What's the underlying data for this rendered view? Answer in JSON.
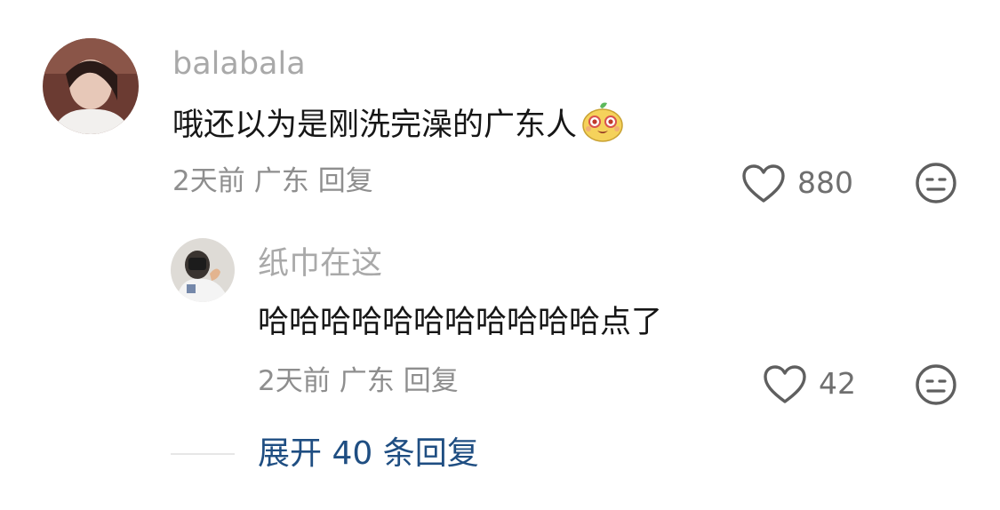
{
  "comments": [
    {
      "username": "balabala",
      "text": "哦还以为是刚洗完澡的广东人",
      "emoji": "melon-face-emoji",
      "meta": {
        "time": "2天前",
        "location": "广东",
        "reply": "回复"
      },
      "likes": "880"
    }
  ],
  "replies": [
    {
      "username": "纸巾在这",
      "text": "哈哈哈哈哈哈哈哈哈哈哈点了",
      "meta": {
        "time": "2天前",
        "location": "广东",
        "reply": "回复"
      },
      "likes": "42"
    }
  ],
  "expand": {
    "label": "展开 40 条回复"
  },
  "colors": {
    "username": "#a9a9a9",
    "text": "#161616",
    "meta": "#8e8e8e",
    "icon": "#5f5f5f",
    "expand": "#1f4e82"
  }
}
